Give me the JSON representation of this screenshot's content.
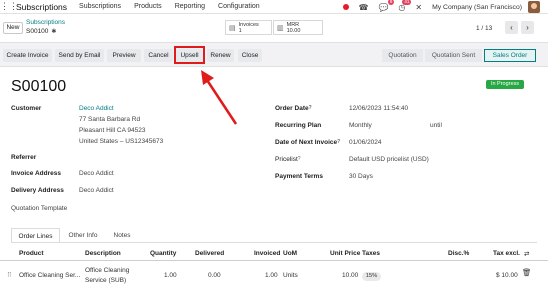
{
  "navbar": {
    "brand": "Subscriptions",
    "menu": [
      "Subscriptions",
      "Products",
      "Reporting",
      "Configuration"
    ],
    "chat_badge": "9",
    "activity_badge": "41",
    "company": "My Company (San Francisco)"
  },
  "control": {
    "new_label": "New",
    "breadcrumb": "Subscriptions",
    "record": "S00100",
    "invoices_label": "Invoices",
    "invoices_count": "1",
    "mrr_label": "MRR",
    "mrr_value": "10.00",
    "pager": "1 / 13"
  },
  "actions": {
    "create_invoice": "Create Invoice",
    "send_email": "Send by Email",
    "preview": "Preview",
    "cancel": "Cancel",
    "upsell": "Upsell",
    "renew": "Renew",
    "close": "Close"
  },
  "statusbar": [
    "Quotation",
    "Quotation Sent",
    "Sales Order"
  ],
  "form": {
    "title": "S00100",
    "ribbon": "In Progress",
    "customer_label": "Customer",
    "customer_name": "Deco Addict",
    "address1": "77 Santa Barbara Rd",
    "address2": "Pleasant Hill CA 94523",
    "address3": "United States – US12345673",
    "referrer_label": "Referrer",
    "invoice_address_label": "Invoice Address",
    "invoice_address": "Deco Addict",
    "delivery_address_label": "Delivery Address",
    "delivery_address": "Deco Addict",
    "quotation_template_label": "Quotation Template",
    "order_date_label": "Order Date",
    "order_date": "12/06/2023 11:54:40",
    "recurring_plan_label": "Recurring Plan",
    "recurring_plan": "Monthly",
    "until_label": "until",
    "next_invoice_label": "Date of Next Invoice",
    "next_invoice": "01/06/2024",
    "pricelist_label": "Pricelist",
    "pricelist": "Default USD pricelist (USD)",
    "payment_terms_label": "Payment Terms",
    "payment_terms": "30 Days",
    "help_mark": "?"
  },
  "tabs": [
    "Order Lines",
    "Other Info",
    "Notes"
  ],
  "table": {
    "headers": [
      "Product",
      "Description",
      "Quantity",
      "Delivered",
      "Invoiced",
      "UoM",
      "Unit Price",
      "Taxes",
      "Disc.%",
      "Tax excl."
    ],
    "rows": [
      {
        "product": "Office Cleaning Ser...",
        "description_1": "Office Cleaning",
        "description_2": "Service (SUB)",
        "quantity": "1.00",
        "delivered": "0.00",
        "invoiced": "1.00",
        "uom": "Units",
        "unit_price": "10.00",
        "taxes": "15%",
        "discount": "",
        "subtotal": "$ 10.00"
      }
    ]
  },
  "colors": {
    "accent": "#017e84",
    "highlight": "#e01b1b",
    "ribbon": "#28a745"
  }
}
